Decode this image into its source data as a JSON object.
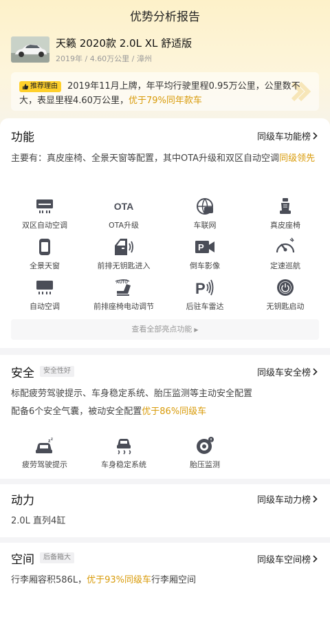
{
  "header": {
    "title": "优势分析报告"
  },
  "car": {
    "name": "天籁 2020款 2.0L XL 舒适版",
    "meta": "2019年 / 4.60万公里 / 漳州",
    "reason_badge": "推荐理由",
    "reason_text": "2019年11月上牌，年平均行驶里程0.95万公里，公里数不大，表显里程4.60万公里，",
    "reason_highlight": "优于79%同年款车"
  },
  "function": {
    "title": "功能",
    "rank_link": "同级车功能榜",
    "desc": "主要有：真皮座椅、全景天窗等配置，其中OTA升级和双区自动空调",
    "desc_highlight": "同级领先",
    "features": [
      {
        "label": "双区自动空调",
        "icon": "dual-zone-ac-icon"
      },
      {
        "label": "OTA升级",
        "icon": "ota-icon"
      },
      {
        "label": "车联网",
        "icon": "connected-car-icon"
      },
      {
        "label": "真皮座椅",
        "icon": "leather-seat-icon"
      },
      {
        "label": "全景天窗",
        "icon": "sunroof-icon"
      },
      {
        "label": "前排无钥匙进入",
        "icon": "keyless-entry-icon"
      },
      {
        "label": "倒车影像",
        "icon": "reverse-camera-icon"
      },
      {
        "label": "定速巡航",
        "icon": "cruise-control-icon"
      },
      {
        "label": "自动空调",
        "icon": "auto-ac-icon"
      },
      {
        "label": "前排座椅电动调节",
        "icon": "power-seat-icon"
      },
      {
        "label": "后驻车雷达",
        "icon": "parking-radar-icon"
      },
      {
        "label": "无钥匙启动",
        "icon": "keyless-start-icon"
      }
    ],
    "ota_icon_text": "OTA",
    "auto_icon_text": "AUTO",
    "more_label": "查看全部亮点功能"
  },
  "safety": {
    "title": "安全",
    "tag": "安全性好",
    "rank_link": "同级车安全榜",
    "desc1": "标配疲劳驾驶提示、车身稳定系统、胎压监测等主动安全配置",
    "desc2": "配备6个安全气囊，被动安全配置",
    "desc2_highlight": "优于86%同级车",
    "features": [
      {
        "label": "疲劳驾驶提示",
        "icon": "fatigue-alert-icon"
      },
      {
        "label": "车身稳定系统",
        "icon": "stability-control-icon"
      },
      {
        "label": "胎压监测",
        "icon": "tire-pressure-icon"
      }
    ]
  },
  "power": {
    "title": "动力",
    "rank_link": "同级车动力榜",
    "desc": "2.0L 直列4缸"
  },
  "space": {
    "title": "空间",
    "tag": "后备箱大",
    "rank_link": "同级车空间榜",
    "desc": "行李厢容积586L，",
    "desc_highlight": "优于93%同级车",
    "desc_tail": "行李厢空间"
  },
  "colors": {
    "accent": "#d89a08",
    "badge": "#ffd02b",
    "icon": "#4a4d57"
  }
}
